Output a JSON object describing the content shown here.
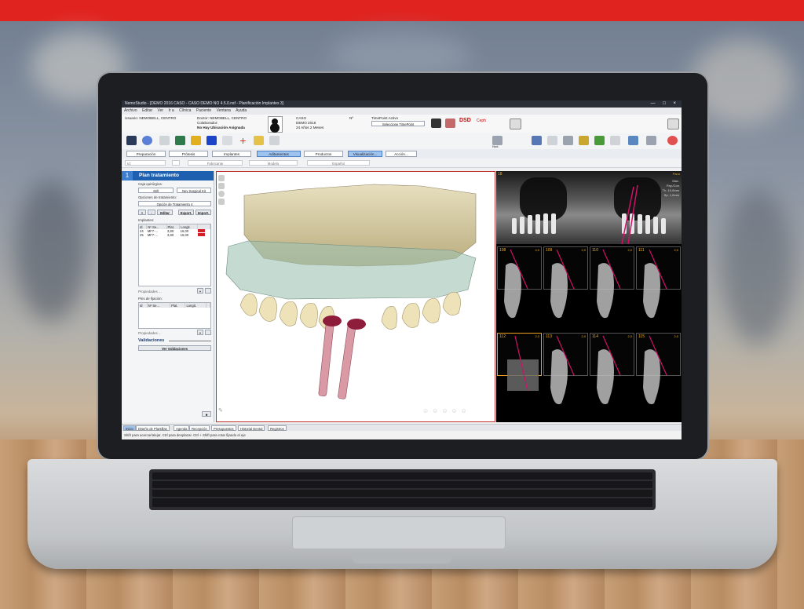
{
  "window": {
    "title": "NemoStudio - [DEMO 2016 CASO - CASO DEMO NO 4.5.0.nsf - Planificación Implantes 3]"
  },
  "menu": [
    "Archivo",
    "Editar",
    "Ver",
    "Ir a",
    "Clínica",
    "Paciente",
    "Ventana",
    "Ayuda"
  ],
  "patient": {
    "user_label": "Usuario: NEMOBELL, CENTRO",
    "doctor_label": "Doctor: NEMOBELL, CENTRO",
    "collaborator_label": "Colaborador:",
    "location_label": "No Hay Ubicación Asignada",
    "case_label": "CASO",
    "case_name": "DEMO 2016",
    "age": "24 Años 2 Meses",
    "case_no": "Nº",
    "timepoint_title": "TimePoint Activo",
    "timepoint_select": "Seleccione TimePoint"
  },
  "toolbar": {
    "dsd_label": "DSD",
    "ceph_label": "Ceph",
    "export_label": "Nud."
  },
  "phases": [
    "Preparación",
    "Prótesis",
    "Implantes",
    "Aditamentos",
    "Productos",
    "Visualización...",
    "Acción..."
  ],
  "subbar": [
    "Id:",
    "Fabricante",
    "Modelo",
    "Español"
  ],
  "left_panel": {
    "step_number": "1",
    "title": "Plan tratamiento",
    "caja_label": "Caja quirúrgica:",
    "caja_value": "Mill",
    "kit_value": "Nev Surgical Kit",
    "options_label": "Opciones de tratamiento:",
    "option_value": "Opción de Tratamiento 4",
    "btn_plus": "+",
    "btn_minus": "-",
    "btn_edit": "Editar",
    "btn_export": "Export.",
    "btn_import": "Import.",
    "implants_label": "Implantes:",
    "implant_headers": [
      "Id",
      "Nº Se...",
      "Plat.",
      "Longit.",
      ""
    ],
    "implants": [
      {
        "id": "24",
        "serie": "MF7-...",
        "plat": "3,80",
        "long": "16,00"
      },
      {
        "id": "25",
        "serie": "MF7-...",
        "plat": "3,80",
        "long": "16,00"
      }
    ],
    "props_label": "Propiedades ...",
    "pins_label": "Pins de fijación:",
    "pin_headers": [
      "Id",
      "Nº Se...",
      "Plat.",
      "Longit.",
      ""
    ],
    "props2_label": "Propiedades ...",
    "validations_label": "Validaciones",
    "view_validations": "Ver Validaciones"
  },
  "panorama": {
    "slice_id": "18",
    "pano_label": "Pano",
    "info": [
      "Max.",
      "Pay./Con",
      "Th. 10,0mm",
      "Sp. 1,0mm"
    ]
  },
  "slices": [
    {
      "n": "108",
      "v": "4,0"
    },
    {
      "n": "109",
      "v": "2,0"
    },
    {
      "n": "110",
      "v": "2,0"
    },
    {
      "n": "111",
      "v": "2,0"
    },
    {
      "n": "112",
      "v": "2,0"
    },
    {
      "n": "113",
      "v": "2,0"
    },
    {
      "n": "114",
      "v": "2,0"
    },
    {
      "n": "115",
      "v": "2,0"
    }
  ],
  "bottom_tabs": [
    "Inicio",
    "Diseño de Plantillas",
    "Agenda",
    "Recepción",
    "Presupuestos",
    "Historial Dental",
    "Registros"
  ],
  "status": "Shift para acercar/alejar. Ctrl para desplazar. Ctrl + Shift para rotar fijando el eje"
}
